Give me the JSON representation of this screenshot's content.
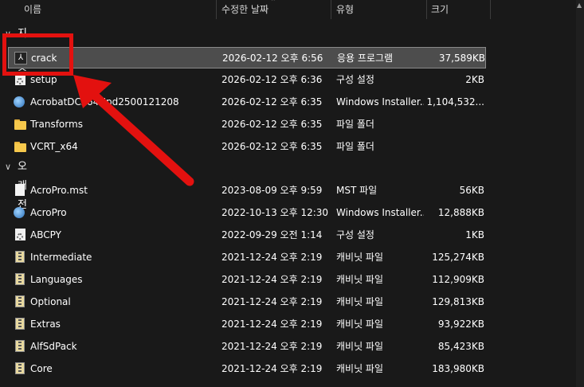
{
  "columns": {
    "name": "이름",
    "date": "수정한 날짜",
    "type": "유형",
    "size": "크기"
  },
  "groups": {
    "recent": "지난 주",
    "old": "오래 전"
  },
  "rows": [
    {
      "name": "crack",
      "date": "2026-02-12 오후 6:56",
      "type": "응용 프로그램",
      "size": "37,589KB",
      "icon": "pdf-app-icon"
    },
    {
      "name": "setup",
      "date": "2026-02-12 오후 6:36",
      "type": "구성 설정",
      "size": "2KB",
      "icon": "settings-file-icon"
    },
    {
      "name": "AcrobatDCx64Upd2500121208",
      "date": "2026-02-12 오후 6:35",
      "type": "Windows Installer...",
      "size": "1,104,532...",
      "icon": "installer-icon"
    },
    {
      "name": "Transforms",
      "date": "2026-02-12 오후 6:35",
      "type": "파일 폴더",
      "size": "",
      "icon": "folder-icon"
    },
    {
      "name": "VCRT_x64",
      "date": "2026-02-12 오후 6:35",
      "type": "파일 폴더",
      "size": "",
      "icon": "folder-icon"
    },
    {
      "name": "AcroPro.mst",
      "date": "2023-08-09 오후 9:59",
      "type": "MST 파일",
      "size": "56KB",
      "icon": "file-icon"
    },
    {
      "name": "AcroPro",
      "date": "2022-10-13 오후 12:30",
      "type": "Windows Installer...",
      "size": "12,888KB",
      "icon": "installer-icon"
    },
    {
      "name": "ABCPY",
      "date": "2022-09-29 오전 1:14",
      "type": "구성 설정",
      "size": "1KB",
      "icon": "settings-file-icon"
    },
    {
      "name": "Intermediate",
      "date": "2021-12-24 오후 2:19",
      "type": "캐비닛 파일",
      "size": "125,274KB",
      "icon": "cabinet-icon"
    },
    {
      "name": "Languages",
      "date": "2021-12-24 오후 2:19",
      "type": "캐비닛 파일",
      "size": "112,909KB",
      "icon": "cabinet-icon"
    },
    {
      "name": "Optional",
      "date": "2021-12-24 오후 2:19",
      "type": "캐비닛 파일",
      "size": "129,813KB",
      "icon": "cabinet-icon"
    },
    {
      "name": "Extras",
      "date": "2021-12-24 오후 2:19",
      "type": "캐비닛 파일",
      "size": "93,922KB",
      "icon": "cabinet-icon"
    },
    {
      "name": "AlfSdPack",
      "date": "2021-12-24 오후 2:19",
      "type": "캐비닛 파일",
      "size": "85,423KB",
      "icon": "cabinet-icon"
    },
    {
      "name": "Core",
      "date": "2021-12-24 오후 2:19",
      "type": "캐비닛 파일",
      "size": "183,980KB",
      "icon": "cabinet-icon"
    }
  ],
  "colors": {
    "background": "#191919",
    "selection": "#4d4d4d",
    "annotation": "#e3110f"
  }
}
